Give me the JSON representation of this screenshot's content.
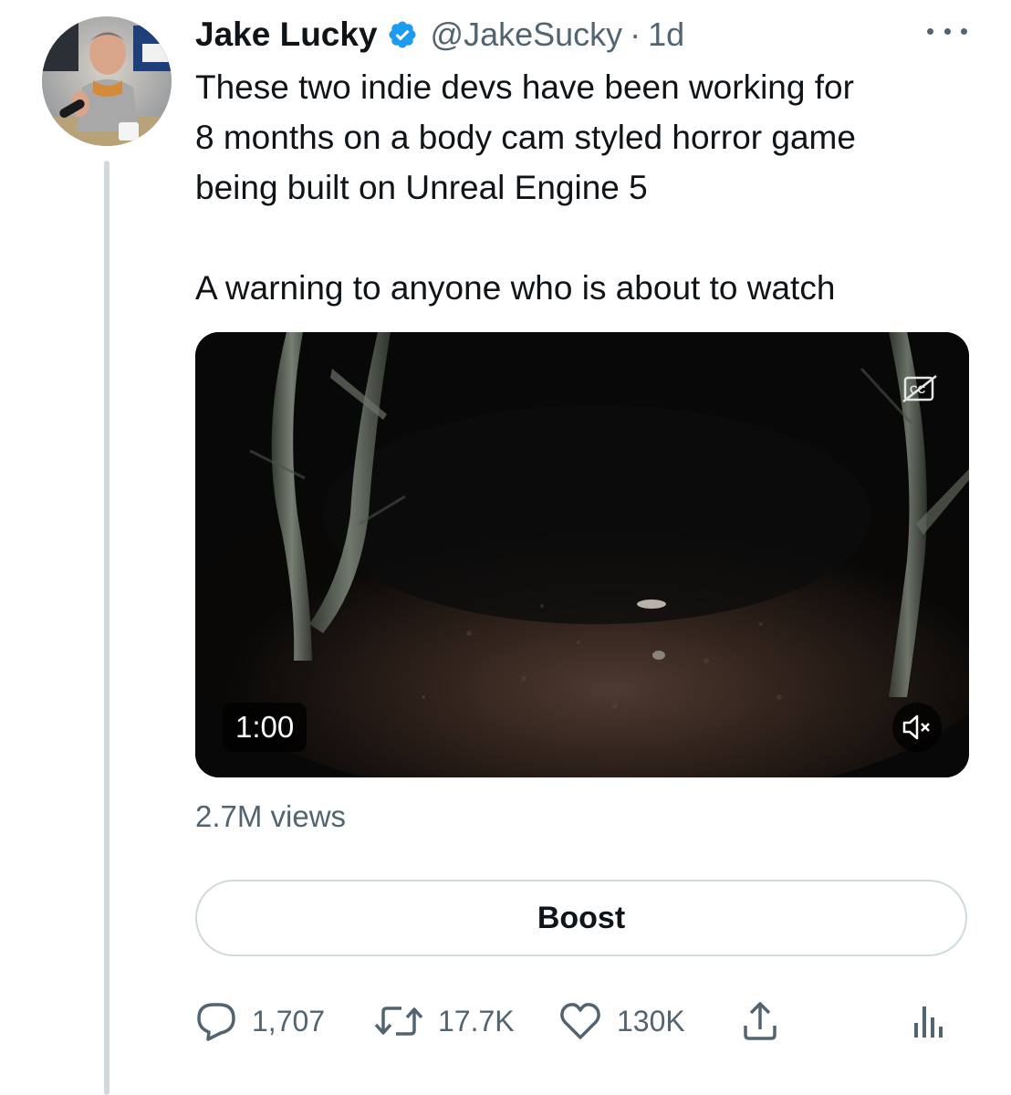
{
  "tweet": {
    "author_name": "Jake Lucky",
    "verified": true,
    "handle": "@JakeSucky",
    "separator": "·",
    "time": "1d",
    "text_lines": [
      "These two indie devs have been working for",
      "8 months on a body cam styled horror game",
      "being built on Unreal Engine 5"
    ],
    "text_line_2": "A warning to anyone who is about to watch",
    "media": {
      "type": "video",
      "duration": "1:00",
      "captions_icon": "captions-off-icon",
      "mute_icon": "volume-muted-icon"
    },
    "views": "2.7M views",
    "boost_label": "Boost",
    "actions": {
      "replies": "1,707",
      "retweets": "17.7K",
      "likes": "130K",
      "share_icon": "share-icon",
      "analytics_icon": "analytics-icon"
    }
  },
  "colors": {
    "primary_text": "#0f1419",
    "secondary_text": "#536471",
    "verified_blue": "#1d9bf0",
    "border": "#cfd9de"
  }
}
